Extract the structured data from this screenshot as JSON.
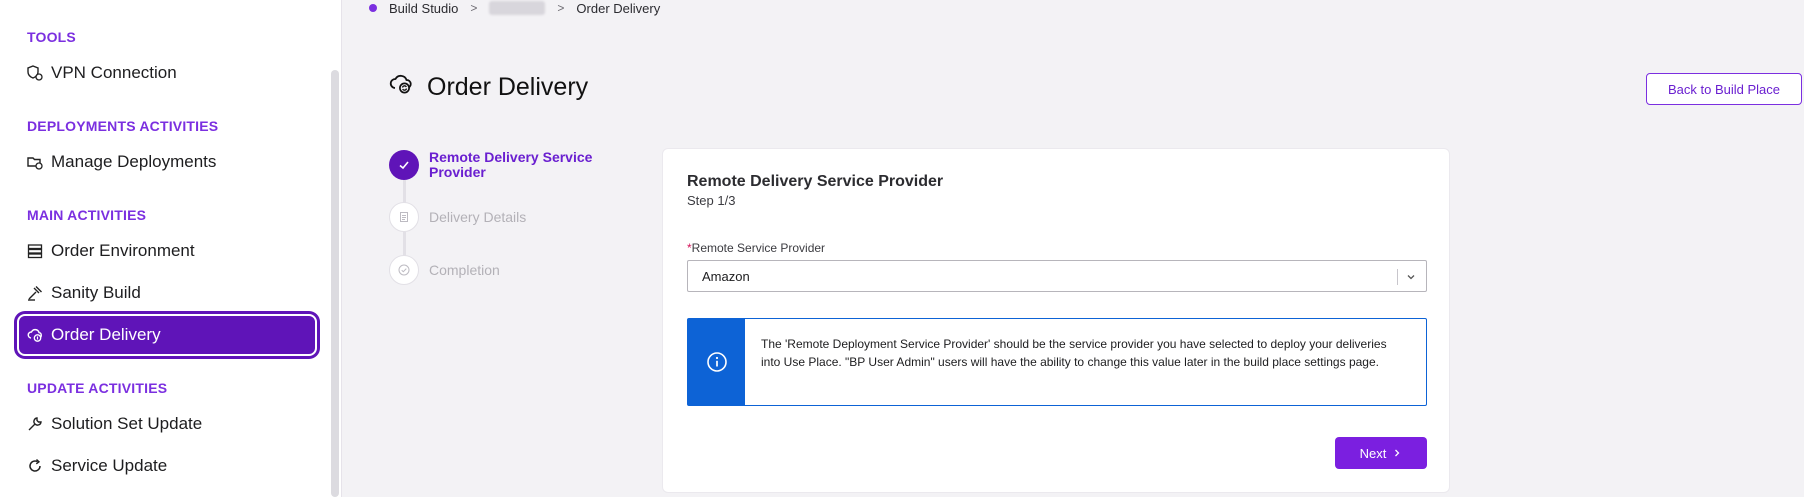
{
  "sidebar": {
    "sections": [
      {
        "title": "TOOLS"
      },
      {
        "title": "DEPLOYMENTS ACTIVITIES"
      },
      {
        "title": "MAIN ACTIVITIES"
      },
      {
        "title": "UPDATE ACTIVITIES"
      }
    ],
    "items": [
      {
        "label": "VPN Connection",
        "icon": "shield-network-icon"
      },
      {
        "label": "Manage Deployments",
        "icon": "deployments-icon"
      },
      {
        "label": "Order Environment",
        "icon": "server-stack-icon"
      },
      {
        "label": "Sanity Build",
        "icon": "hammer-icon"
      },
      {
        "label": "Order Delivery",
        "icon": "cloud-delivery-icon",
        "active": true
      },
      {
        "label": "Solution Set Update",
        "icon": "wrench-icon"
      },
      {
        "label": "Service Update",
        "icon": "refresh-icon"
      }
    ]
  },
  "breadcrumb": {
    "items": [
      "Build Studio",
      "Order Delivery"
    ],
    "separator": ">"
  },
  "header": {
    "title": "Order Delivery",
    "back_label": "Back to Build Place"
  },
  "steps": [
    {
      "label": "Remote Delivery Service Provider",
      "state": "done"
    },
    {
      "label": "Delivery Details",
      "state": "pending"
    },
    {
      "label": "Completion",
      "state": "pending"
    }
  ],
  "card": {
    "title": "Remote Delivery Service Provider",
    "step": "Step 1/3",
    "field_required_mark": "*",
    "field_label": "Remote Service Provider",
    "field_value": "Amazon",
    "info_text": "The 'Remote Deployment Service Provider' should be the service provider you have selected to deploy your deliveries into Use Place. \"BP User Admin\" users will have the ability to change this value later in the build place settings page.",
    "next_label": "Next"
  },
  "colors": {
    "accent": "#7b2fe0",
    "active_bg": "#5f14b8",
    "info_blue": "#0d63d6"
  }
}
